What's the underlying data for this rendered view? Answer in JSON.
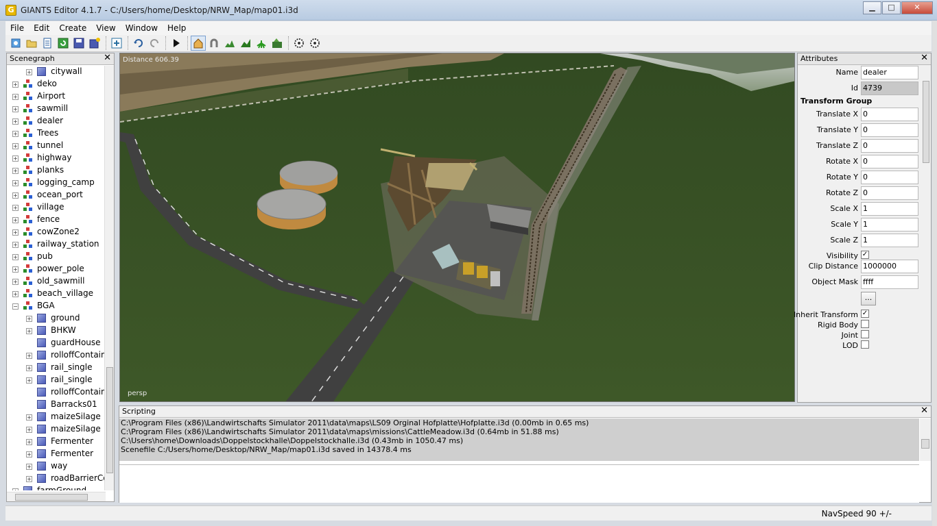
{
  "window": {
    "title": "GIANTS Editor 4.1.7 - C:/Users/home/Desktop/NRW_Map/map01.i3d",
    "app_icon_letter": "G",
    "minimize": "▁",
    "maximize": "□",
    "close": "✕"
  },
  "menu": [
    "File",
    "Edit",
    "Create",
    "View",
    "Window",
    "Help"
  ],
  "toolbar": {
    "icons": [
      "new-icon",
      "open-icon",
      "list-icon",
      "refresh-icon",
      "save-icon",
      "save-as-icon",
      "import-icon",
      "undo-icon",
      "redo-icon",
      "play-icon",
      "home-icon",
      "magnet-icon",
      "terrain-icon",
      "terrain-paint-icon",
      "foliage-icon",
      "terrain-edit-icon",
      "gear-icon",
      "gear2-icon"
    ]
  },
  "scenegraph": {
    "title": "Scenegraph",
    "close": "✕",
    "items": [
      {
        "label": "citywall",
        "level": 1,
        "type": "cube"
      },
      {
        "label": "deko",
        "level": 0,
        "type": "tg"
      },
      {
        "label": "Airport",
        "level": 0,
        "type": "tg"
      },
      {
        "label": "sawmill",
        "level": 0,
        "type": "tg"
      },
      {
        "label": "dealer",
        "level": 0,
        "type": "tg"
      },
      {
        "label": "Trees",
        "level": 0,
        "type": "tg"
      },
      {
        "label": "tunnel",
        "level": 0,
        "type": "tg"
      },
      {
        "label": "highway",
        "level": 0,
        "type": "tg"
      },
      {
        "label": "planks",
        "level": 0,
        "type": "tg"
      },
      {
        "label": "logging_camp",
        "level": 0,
        "type": "tg"
      },
      {
        "label": "ocean_port",
        "level": 0,
        "type": "tg"
      },
      {
        "label": "village",
        "level": 0,
        "type": "tg"
      },
      {
        "label": "fence",
        "level": 0,
        "type": "tg"
      },
      {
        "label": "cowZone2",
        "level": 0,
        "type": "tg"
      },
      {
        "label": "railway_station",
        "level": 0,
        "type": "tg"
      },
      {
        "label": "pub",
        "level": 0,
        "type": "tg"
      },
      {
        "label": "power_pole",
        "level": 0,
        "type": "tg"
      },
      {
        "label": "old_sawmill",
        "level": 0,
        "type": "tg"
      },
      {
        "label": "beach_village",
        "level": 0,
        "type": "tg"
      },
      {
        "label": "BGA",
        "level": 0,
        "type": "tg",
        "expanded": true
      },
      {
        "label": "ground",
        "level": 1,
        "type": "cube"
      },
      {
        "label": "BHKW",
        "level": 1,
        "type": "cube"
      },
      {
        "label": "guardHouse",
        "level": 1,
        "type": "cube",
        "noexp": true
      },
      {
        "label": "rolloffContaine",
        "level": 1,
        "type": "cube"
      },
      {
        "label": "rail_single",
        "level": 1,
        "type": "cube"
      },
      {
        "label": "rail_single",
        "level": 1,
        "type": "cube"
      },
      {
        "label": "rolloffContaine",
        "level": 1,
        "type": "cube",
        "noexp": true
      },
      {
        "label": "Barracks01",
        "level": 1,
        "type": "cube",
        "noexp": true
      },
      {
        "label": "maizeSilage",
        "level": 1,
        "type": "cube"
      },
      {
        "label": "maizeSilage",
        "level": 1,
        "type": "cube"
      },
      {
        "label": "Fermenter",
        "level": 1,
        "type": "cube"
      },
      {
        "label": "Fermenter",
        "level": 1,
        "type": "cube"
      },
      {
        "label": "way",
        "level": 1,
        "type": "cube"
      },
      {
        "label": "roadBarrierCor",
        "level": 1,
        "type": "cube"
      },
      {
        "label": "farmGround",
        "level": 0,
        "type": "cube"
      }
    ]
  },
  "viewport": {
    "distance_label": "Distance 606.39",
    "camera_label": "persp"
  },
  "attributes": {
    "title": "Attributes",
    "close": "✕",
    "name_label": "Name",
    "name_value": "dealer",
    "id_label": "Id",
    "id_value": "4739",
    "group_title": "Transform Group",
    "fields": [
      {
        "label": "Translate X",
        "value": "0"
      },
      {
        "label": "Translate Y",
        "value": "0"
      },
      {
        "label": "Translate Z",
        "value": "0"
      },
      {
        "label": "Rotate X",
        "value": "0"
      },
      {
        "label": "Rotate Y",
        "value": "0"
      },
      {
        "label": "Rotate Z",
        "value": "0"
      },
      {
        "label": "Scale X",
        "value": "1"
      },
      {
        "label": "Scale Y",
        "value": "1"
      },
      {
        "label": "Scale Z",
        "value": "1"
      }
    ],
    "visibility_label": "Visibility",
    "visibility_checked": true,
    "clip_label": "Clip Distance",
    "clip_value": "1000000",
    "mask_label": "Object Mask",
    "mask_value": "ffff",
    "dots_button": "...",
    "checks": [
      {
        "label": "Inherit Transform",
        "checked": true
      },
      {
        "label": "Rigid Body",
        "checked": false
      },
      {
        "label": "Joint",
        "checked": false
      },
      {
        "label": "LOD",
        "checked": false
      }
    ]
  },
  "scripting": {
    "title": "Scripting",
    "close": "✕",
    "lines": [
      "C:\\Program Files (x86)\\Landwirtschafts Simulator 2011\\data\\maps\\LS09 Orginal Hofplatte\\Hofplatte.i3d (0.00mb in 0.65 ms)",
      "C:\\Program Files (x86)\\Landwirtschafts Simulator 2011\\data\\maps\\missions\\CattleMeadow.i3d (0.64mb in 51.88 ms)",
      "C:\\Users\\home\\Downloads\\Doppelstockhalle\\Doppelstockhalle.i3d (0.43mb in 1050.47 ms)",
      "Scenefile C:/Users/home/Desktop/NRW_Map/map01.i3d saved in 14378.4 ms"
    ]
  },
  "status": {
    "navspeed": "NavSpeed 90 +/-"
  }
}
